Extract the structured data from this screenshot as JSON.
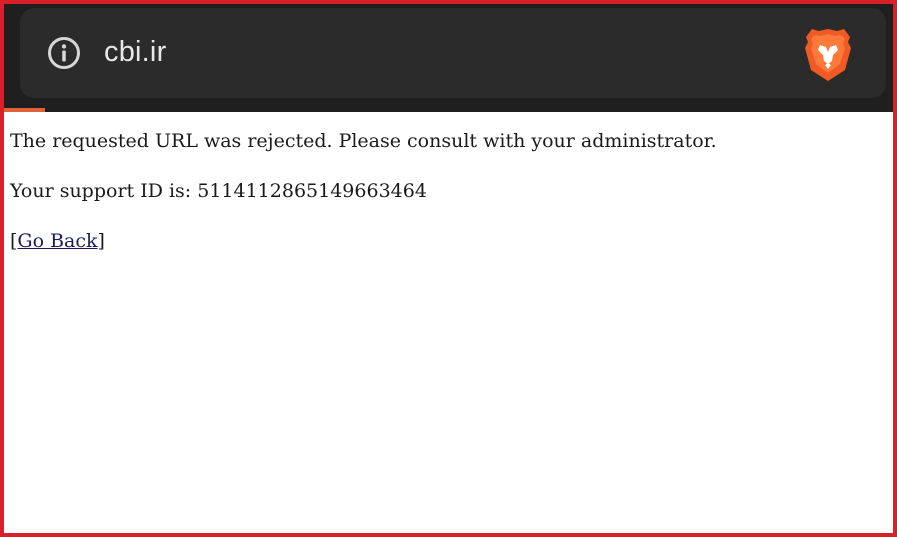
{
  "browser": {
    "url": "cbi.ir",
    "site_info_icon": "info-circle-icon",
    "brave_icon": "brave-lion-icon",
    "accent_color": "#e0623a",
    "toolbar_color": "#2b2b2b"
  },
  "page": {
    "message": "The requested URL was rejected. Please consult with your administrator.",
    "support_id_line": "Your support ID is: 5114112865149663464",
    "go_back_open": "[",
    "go_back_label": "Go Back",
    "go_back_close": "]"
  },
  "frame": {
    "border_color": "#d8202a"
  }
}
